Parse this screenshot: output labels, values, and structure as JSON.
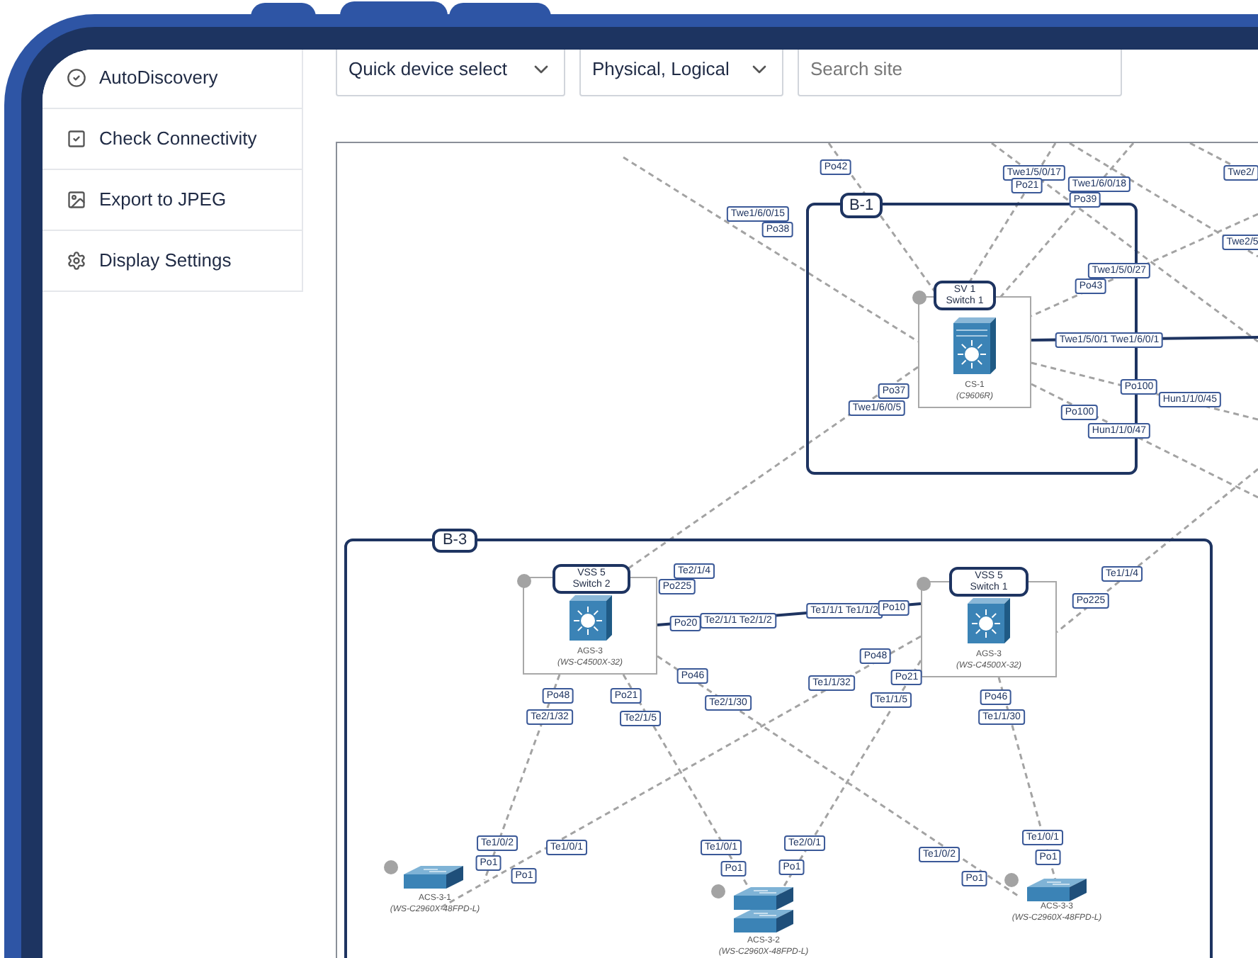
{
  "menu": [
    {
      "label": "AutoDiscovery",
      "kind": "discovery"
    },
    {
      "label": "Check Connectivity",
      "kind": "check"
    },
    {
      "label": "Export to JPEG",
      "kind": "image"
    },
    {
      "label": "Display Settings",
      "kind": "settings"
    }
  ],
  "toolbar": {
    "device_select": {
      "value": "Quick device select"
    },
    "layer_select": {
      "value": "Physical, Logical"
    },
    "search": {
      "placeholder": "Search site"
    }
  },
  "topology": {
    "groups": [
      {
        "label": "B-1"
      },
      {
        "label": "B-3"
      }
    ],
    "devices": [
      {
        "kind": "core",
        "title": "SV 1",
        "subtitle": "Switch 1",
        "name": "CS-1",
        "model": "(C9606R)"
      },
      {
        "kind": "distribution",
        "title": "VSS 5",
        "subtitle": "Switch 2",
        "name": "AGS-3",
        "model": "(WS-C4500X-32)"
      },
      {
        "kind": "distribution",
        "title": "VSS 5",
        "subtitle": "Switch 1",
        "name": "AGS-3",
        "model": "(WS-C4500X-32)"
      },
      {
        "kind": "access",
        "name": "ACS-3-1",
        "model": "(WS-C2960X-48FPD-L)"
      },
      {
        "kind": "access_stack",
        "name": "ACS-3-2",
        "model": "(WS-C2960X-48FPD-L)"
      },
      {
        "kind": "access",
        "name": "ACS-3-3",
        "model": "(WS-C2960X-48FPD-L)"
      }
    ],
    "link_labels": [
      "Po42",
      "Twe1/6/0/15",
      "Po38",
      "Twe1/5/0/17",
      "Po21",
      "Twe1/6/0/18",
      "Po39",
      "Twe2/",
      "Twe2/5",
      "Twe1/5/0/27",
      "Po43",
      "Twe1/5/0/1 Twe1/6/0/1",
      "Po37",
      "Twe1/6/0/5",
      "Po100",
      "Hun1/1/0/45",
      "Po100",
      "Hun1/1/0/47",
      "Te2/1/4",
      "Po225",
      "Po20",
      "Te2/1/1 Te2/1/2",
      "Po46",
      "Te2/1/30",
      "Po48",
      "Te2/1/32",
      "Po21",
      "Te2/1/5",
      "Te1/1/1 Te1/1/2",
      "Po10",
      "Te1/1/4",
      "Po225",
      "Po48",
      "Te1/1/32",
      "Po21",
      "Te1/1/5",
      "Po46",
      "Te1/1/30",
      "Te1/0/2",
      "Po1",
      "Te1/0/1",
      "Po1",
      "Te1/0/1",
      "Po1",
      "Te2/0/1",
      "Po1",
      "Te1/0/2",
      "Po1",
      "Te1/0/1",
      "Po1"
    ]
  }
}
